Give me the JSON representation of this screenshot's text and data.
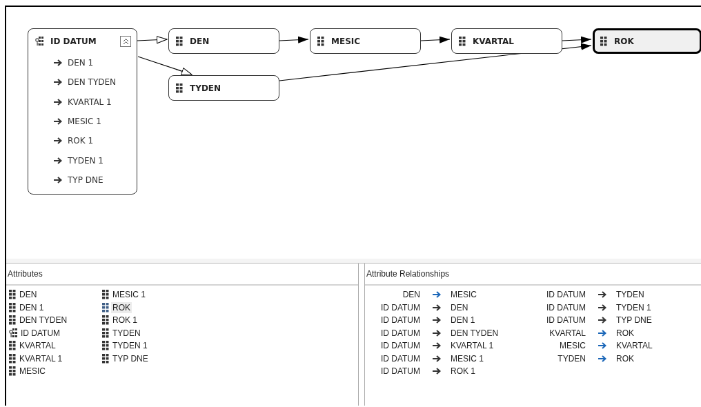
{
  "diagram": {
    "nodes": [
      {
        "kind": "key",
        "name": "ID DATUM",
        "selected": false,
        "expanded": true,
        "children": [
          "DEN 1",
          "DEN TYDEN",
          "KVARTAL 1",
          "MESIC 1",
          "ROK 1",
          "TYDEN 1",
          "TYP DNE"
        ]
      },
      {
        "kind": "attribute",
        "name": "DEN",
        "selected": false
      },
      {
        "kind": "attribute",
        "name": "MESIC",
        "selected": false
      },
      {
        "kind": "attribute",
        "name": "KVARTAL",
        "selected": false
      },
      {
        "kind": "attribute",
        "name": "ROK",
        "selected": true
      },
      {
        "kind": "attribute",
        "name": "TYDEN",
        "selected": false
      }
    ],
    "edges": [
      {
        "kind": "flexible"
      },
      {
        "kind": "flexible"
      },
      {
        "kind": "rigid"
      },
      {
        "kind": "rigid"
      },
      {
        "kind": "rigid"
      },
      {
        "kind": "rigid"
      }
    ]
  },
  "attributes": {
    "title": "Attributes",
    "items": [
      {
        "kind": "attribute",
        "name": "DEN",
        "selected": false
      },
      {
        "kind": "attribute",
        "name": "DEN 1",
        "selected": false
      },
      {
        "kind": "attribute",
        "name": "DEN TYDEN",
        "selected": false
      },
      {
        "kind": "key",
        "name": "ID DATUM",
        "selected": false
      },
      {
        "kind": "attribute",
        "name": "KVARTAL",
        "selected": false
      },
      {
        "kind": "attribute",
        "name": "KVARTAL 1",
        "selected": false
      },
      {
        "kind": "attribute",
        "name": "MESIC",
        "selected": false
      },
      {
        "kind": "attribute",
        "name": "MESIC 1",
        "selected": false
      },
      {
        "kind": "attribute",
        "name": "ROK",
        "selected": true
      },
      {
        "kind": "attribute",
        "name": "ROK 1",
        "selected": false
      },
      {
        "kind": "attribute",
        "name": "TYDEN",
        "selected": false
      },
      {
        "kind": "attribute",
        "name": "TYDEN 1",
        "selected": false
      },
      {
        "kind": "attribute",
        "name": "TYP DNE",
        "selected": false
      }
    ]
  },
  "relationships": {
    "title": "Attribute Relationships",
    "items": [
      {
        "source": "DEN",
        "target": "MESIC",
        "kind": "rigid"
      },
      {
        "source": "ID DATUM",
        "target": "DEN",
        "kind": "flexible"
      },
      {
        "source": "ID DATUM",
        "target": "DEN 1",
        "kind": "flexible"
      },
      {
        "source": "ID DATUM",
        "target": "DEN TYDEN",
        "kind": "flexible"
      },
      {
        "source": "ID DATUM",
        "target": "KVARTAL 1",
        "kind": "flexible"
      },
      {
        "source": "ID DATUM",
        "target": "MESIC 1",
        "kind": "flexible"
      },
      {
        "source": "ID DATUM",
        "target": "ROK 1",
        "kind": "flexible"
      },
      {
        "source": "ID DATUM",
        "target": "TYDEN",
        "kind": "flexible"
      },
      {
        "source": "ID DATUM",
        "target": "TYDEN 1",
        "kind": "flexible"
      },
      {
        "source": "ID DATUM",
        "target": "TYP DNE",
        "kind": "flexible"
      },
      {
        "source": "KVARTAL",
        "target": "ROK",
        "kind": "rigid"
      },
      {
        "source": "MESIC",
        "target": "KVARTAL",
        "kind": "rigid"
      },
      {
        "source": "TYDEN",
        "target": "ROK",
        "kind": "rigid"
      }
    ]
  }
}
